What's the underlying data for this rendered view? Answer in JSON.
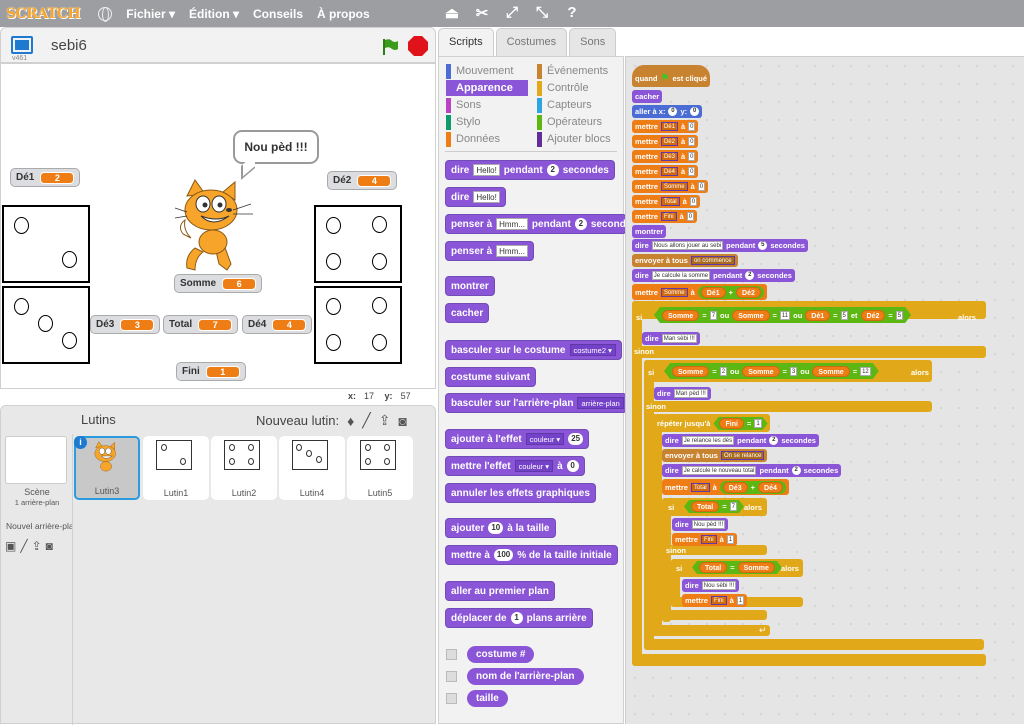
{
  "menubar": {
    "logo": "SCRATCH",
    "items": [
      "Fichier ▾",
      "Édition ▾",
      "Conseils",
      "À propos"
    ],
    "tools": [
      "duplicate-icon",
      "cut-icon",
      "grow-icon",
      "shrink-icon",
      "help-icon"
    ]
  },
  "stage": {
    "project_name": "sebi6",
    "version": "v461",
    "speech": "Nou pèd !!!",
    "coords": {
      "x_label": "x:",
      "x": "17",
      "y_label": "y:",
      "y": "57"
    },
    "monitors": [
      {
        "name": "Dé1",
        "value": "2"
      },
      {
        "name": "Dé2",
        "value": "4"
      },
      {
        "name": "Somme",
        "value": "6"
      },
      {
        "name": "Dé3",
        "value": "3"
      },
      {
        "name": "Total",
        "value": "7"
      },
      {
        "name": "Dé4",
        "value": "4"
      },
      {
        "name": "Fini",
        "value": "1"
      }
    ]
  },
  "sprites_panel": {
    "title": "Lutins",
    "new_sprite_label": "Nouveau lutin:",
    "scene_label": "Scène",
    "scene_sub": "1 arrière-plan",
    "new_backdrop_label": "Nouvel arrière-plan",
    "sprites": [
      {
        "name": "Lutin3",
        "selected": true
      },
      {
        "name": "Lutin1"
      },
      {
        "name": "Lutin2"
      },
      {
        "name": "Lutin4"
      },
      {
        "name": "Lutin5"
      }
    ]
  },
  "tabs": [
    "Scripts",
    "Costumes",
    "Sons"
  ],
  "categories": [
    {
      "label": "Mouvement",
      "color": "#4a6cd4"
    },
    {
      "label": "Apparence",
      "color": "#8a55d7",
      "active": true
    },
    {
      "label": "Sons",
      "color": "#bb42c3"
    },
    {
      "label": "Stylo",
      "color": "#0e9a6c"
    },
    {
      "label": "Données",
      "color": "#ee7d16"
    },
    {
      "label": "Événements",
      "color": "#c88330"
    },
    {
      "label": "Contrôle",
      "color": "#e1a91a"
    },
    {
      "label": "Capteurs",
      "color": "#2ca5e2"
    },
    {
      "label": "Opérateurs",
      "color": "#5cb712"
    },
    {
      "label": "Ajouter blocs",
      "color": "#632d99"
    }
  ],
  "palette": {
    "say_secs": {
      "a": "dire",
      "text": "Hello!",
      "b": "pendant",
      "n": "2",
      "c": "secondes"
    },
    "say": {
      "a": "dire",
      "text": "Hello!"
    },
    "think_secs": {
      "a": "penser à",
      "text": "Hmm...",
      "b": "pendant",
      "n": "2",
      "c": "secondes"
    },
    "think": {
      "a": "penser à",
      "text": "Hmm..."
    },
    "show": "montrer",
    "hide": "cacher",
    "switch_costume": {
      "a": "basculer sur le costume",
      "dd": "costume2 ▾"
    },
    "next_costume": "costume suivant",
    "switch_backdrop": {
      "a": "basculer sur l'arrière-plan",
      "dd": "arrière-plan"
    },
    "change_effect": {
      "a": "ajouter à l'effet",
      "dd": "couleur ▾",
      "n": "25"
    },
    "set_effect": {
      "a": "mettre l'effet",
      "dd": "couleur ▾",
      "b": "à",
      "n": "0"
    },
    "clear_effects": "annuler les effets graphiques",
    "change_size": {
      "a": "ajouter",
      "n": "10",
      "b": "à la taille"
    },
    "set_size": {
      "a": "mettre à",
      "n": "100",
      "b": "% de la taille initiale"
    },
    "front": "aller au premier plan",
    "back": {
      "a": "déplacer de",
      "n": "1",
      "b": "plans arrière"
    },
    "reporters": [
      "costume #",
      "nom de l'arrière-plan",
      "taille"
    ]
  },
  "script": {
    "hat": {
      "a": "quand",
      "b": "est cliqué"
    },
    "hide": "cacher",
    "goto": {
      "a": "aller à x:",
      "x": "0",
      "b": "y:",
      "y": "0"
    },
    "set_vars": [
      {
        "var": "Dé1",
        "val": "0"
      },
      {
        "var": "Dé2",
        "val": "0"
      },
      {
        "var": "Dé3",
        "val": "0"
      },
      {
        "var": "Dé4",
        "val": "0"
      },
      {
        "var": "Somme",
        "val": "0"
      },
      {
        "var": "Total",
        "val": "0"
      },
      {
        "var": "Fini",
        "val": "0"
      }
    ],
    "kw": {
      "set": "mettre",
      "to": "à",
      "say": "dire",
      "for": "pendant",
      "secs": "secondes",
      "broadcast": "envoyer à tous",
      "if": "si",
      "then": "alors",
      "else": "sinon",
      "or": "ou",
      "and": "et",
      "eq": "=",
      "plus": "+",
      "repeat_until": "répéter jusqu'à"
    },
    "show": "montrer",
    "say1": {
      "text": "Nous allons jouer au sebi",
      "n": "5"
    },
    "broadcast1": "on commence",
    "say2": {
      "text": "Je calcule la somme",
      "n": "2"
    },
    "sum1": {
      "var": "Somme",
      "a": "Dé1",
      "b": "Dé2"
    },
    "if1": {
      "v1": "Somme",
      "n1": "7",
      "v2": "Somme",
      "n2": "11",
      "v3": "Dé1",
      "n3": "5",
      "v4": "Dé2",
      "n4": "5"
    },
    "win1": "Man sèbi !!!",
    "if2": {
      "v1": "Somme",
      "n1": "2",
      "v2": "Somme",
      "n2": "3",
      "v3": "Somme",
      "n3": "12"
    },
    "lose1": "Man pèd !!!",
    "until": {
      "var": "Fini",
      "n": "1"
    },
    "say3": {
      "text": "Je relance les dés",
      "n": "2"
    },
    "broadcast2": "On se relance",
    "say4": {
      "text": "Je calcule le nouveau total",
      "n": "2"
    },
    "sum2": {
      "var": "Total",
      "a": "Dé3",
      "b": "Dé4"
    },
    "if3": {
      "v": "Total",
      "n": "7"
    },
    "lose2": "Nou pèd !!!",
    "set_fini": {
      "var": "Fini",
      "val": "1"
    },
    "if4": {
      "a": "Total",
      "b": "Somme"
    },
    "win2": "Nou sèbi !!!"
  }
}
